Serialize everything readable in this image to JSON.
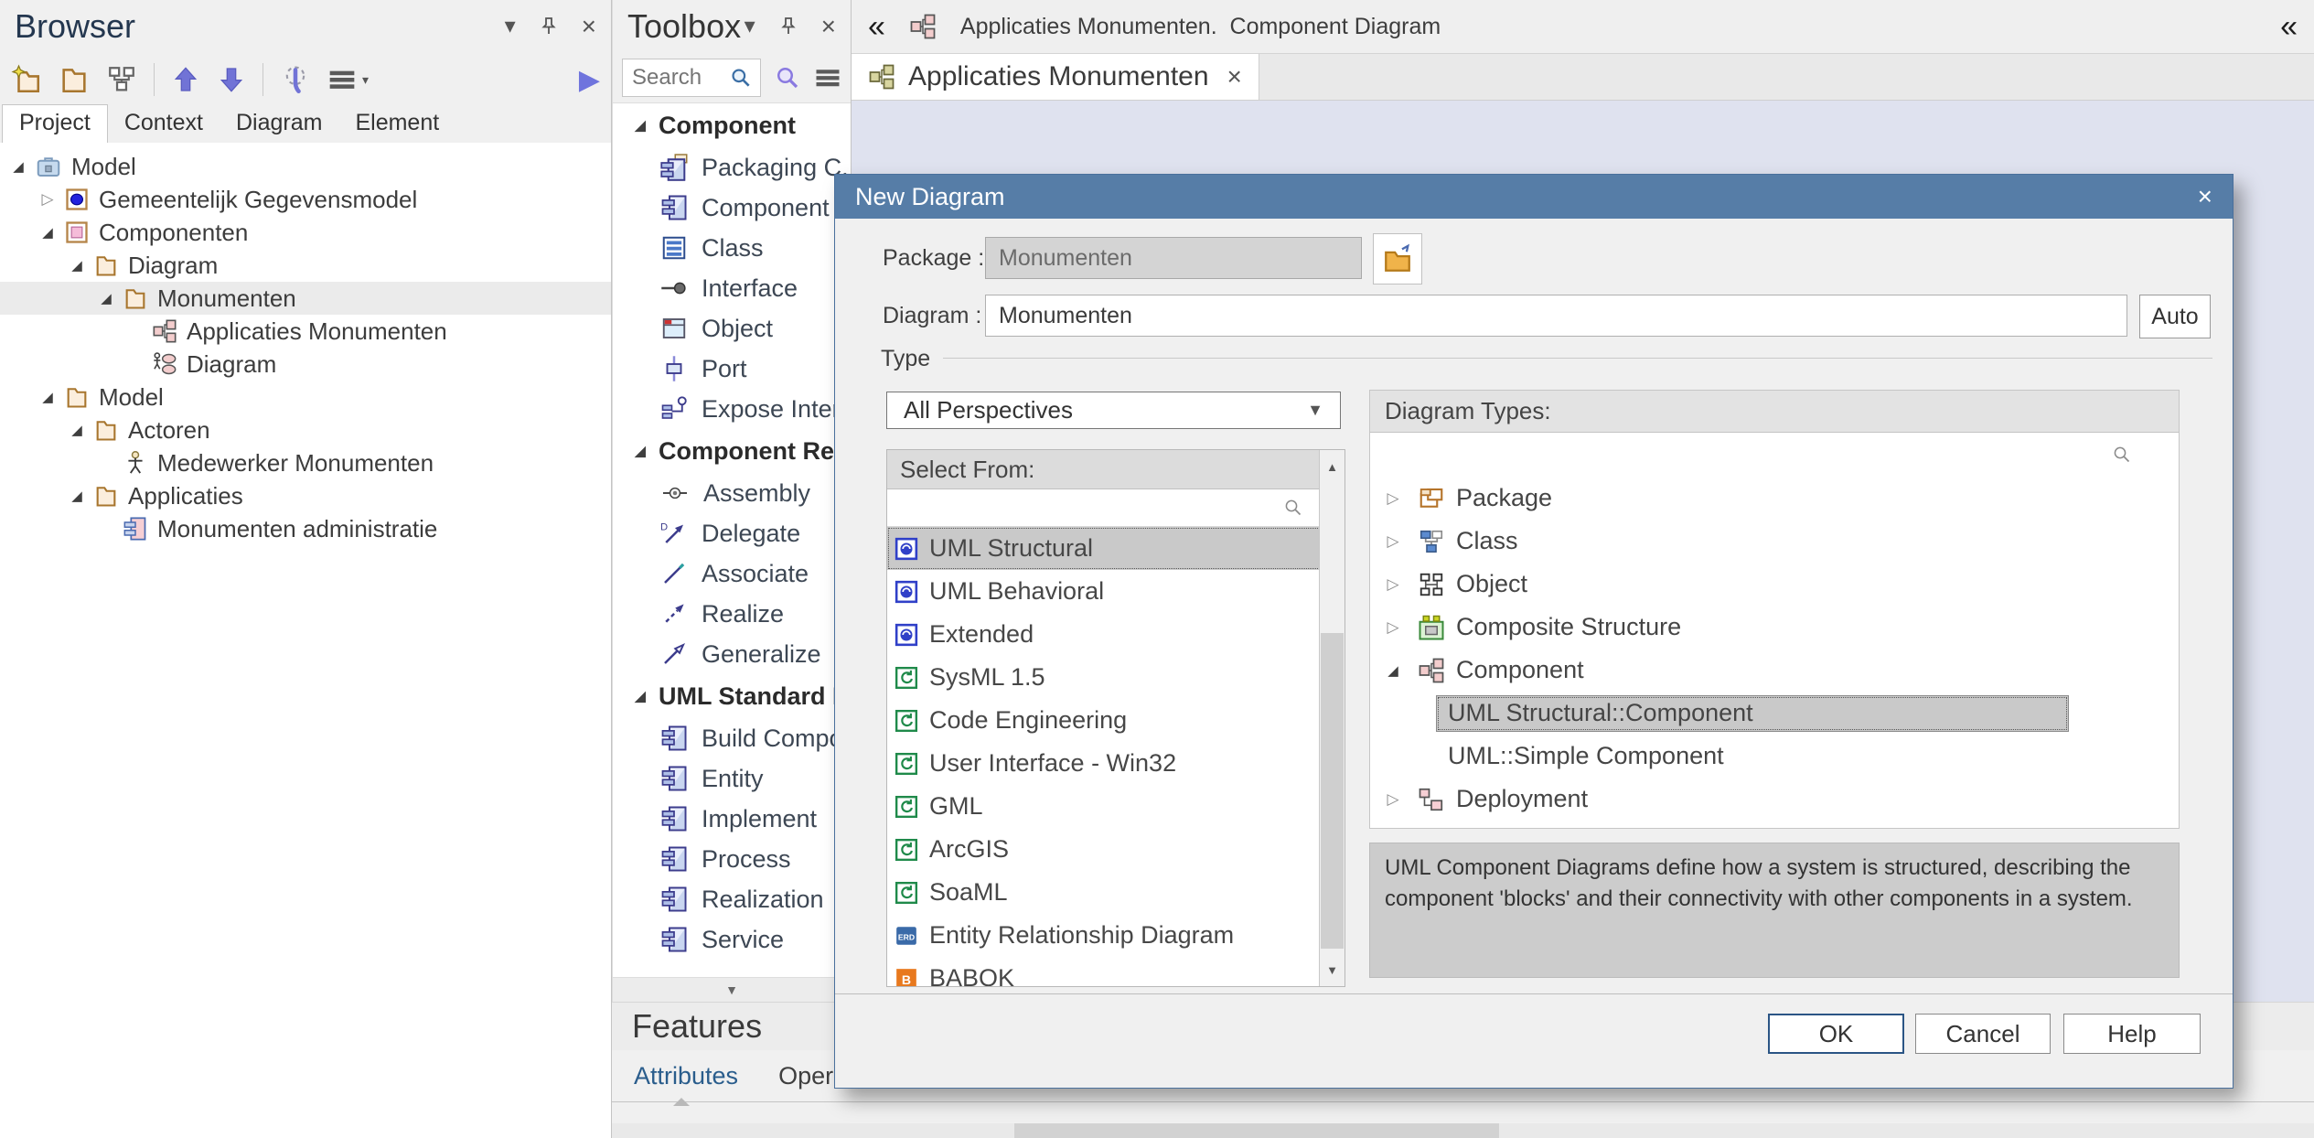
{
  "colors": {
    "dialog_titlebar": "#567da7",
    "canvas": "#dfe2ef",
    "selection_gray": "#c9c9c9",
    "accent_blue": "#7173d6"
  },
  "browser": {
    "title": "Browser",
    "tabs": [
      {
        "label": "Project",
        "active": true
      },
      {
        "label": "Context"
      },
      {
        "label": "Diagram"
      },
      {
        "label": "Element"
      }
    ],
    "tree": [
      {
        "label": "Model"
      },
      {
        "label": "Gemeentelijk Gegevensmodel"
      },
      {
        "label": "Componenten"
      },
      {
        "label": "Diagram"
      },
      {
        "label": "Monumenten"
      },
      {
        "label": "Applicaties Monumenten"
      },
      {
        "label": "Diagram"
      },
      {
        "label": "Model"
      },
      {
        "label": "Actoren"
      },
      {
        "label": "Medewerker Monumenten"
      },
      {
        "label": "Applicaties"
      },
      {
        "label": "Monumenten administratie"
      }
    ]
  },
  "toolbox": {
    "title": "Toolbox",
    "search_placeholder": "Search",
    "sections": [
      {
        "label": "Component",
        "items": [
          {
            "label": "Packaging C..."
          },
          {
            "label": "Component"
          },
          {
            "label": "Class"
          },
          {
            "label": "Interface"
          },
          {
            "label": "Object"
          },
          {
            "label": "Port"
          },
          {
            "label": "Expose Interf..."
          }
        ]
      },
      {
        "label": "Component Relations",
        "items": [
          {
            "label": "Assembly"
          },
          {
            "label": "Delegate"
          },
          {
            "label": "Associate"
          },
          {
            "label": "Realize"
          },
          {
            "label": "Generalize"
          }
        ]
      },
      {
        "label": "UML Standard Profile",
        "items": [
          {
            "label": "Build Compo..."
          },
          {
            "label": "Entity"
          },
          {
            "label": "Implement"
          },
          {
            "label": "Process"
          },
          {
            "label": "Realization"
          },
          {
            "label": "Service"
          }
        ]
      }
    ]
  },
  "features": {
    "title": "Features",
    "tabs": [
      {
        "label": "Attributes",
        "active": true
      },
      {
        "label": "Operations"
      }
    ]
  },
  "main": {
    "breadcrumb": "Applicaties Monumenten.  Component Diagram",
    "tab_title": "Applicaties Monumenten"
  },
  "dialog": {
    "title": "New Diagram",
    "package_label": "Package :",
    "package_value": "Monumenten",
    "diagram_label": "Diagram :",
    "diagram_value": "Monumenten",
    "auto_button": "Auto",
    "type_group_label": "Type",
    "perspective_value": "All Perspectives",
    "select_from_header": "Select From:",
    "select_from": [
      {
        "label": "UML Structural",
        "badge": "uml",
        "selected": true
      },
      {
        "label": "UML Behavioral",
        "badge": "uml"
      },
      {
        "label": "Extended",
        "badge": "uml"
      },
      {
        "label": "SysML 1.5",
        "badge": "profile-green"
      },
      {
        "label": "Code Engineering",
        "badge": "profile-green"
      },
      {
        "label": "User Interface - Win32",
        "badge": "profile-green"
      },
      {
        "label": "GML",
        "badge": "profile-green"
      },
      {
        "label": "ArcGIS",
        "badge": "profile-green"
      },
      {
        "label": "SoaML",
        "badge": "profile-green"
      },
      {
        "label": "Entity Relationship Diagram",
        "badge": "ERD"
      },
      {
        "label": "BABOK",
        "badge": "B"
      }
    ],
    "diagram_types_header": "Diagram Types:",
    "diagram_types": [
      {
        "label": "Package"
      },
      {
        "label": "Class"
      },
      {
        "label": "Object"
      },
      {
        "label": "Composite Structure"
      },
      {
        "label": "Component",
        "expanded": true
      },
      {
        "label": "UML Structural::Component",
        "child": true,
        "selected": true
      },
      {
        "label": "UML::Simple Component",
        "child": true
      },
      {
        "label": "Deployment"
      }
    ],
    "description": "UML Component Diagrams define how a system is structured, describing the component 'blocks' and their connectivity with other components in a system.",
    "buttons": {
      "ok": "OK",
      "cancel": "Cancel",
      "help": "Help"
    }
  }
}
